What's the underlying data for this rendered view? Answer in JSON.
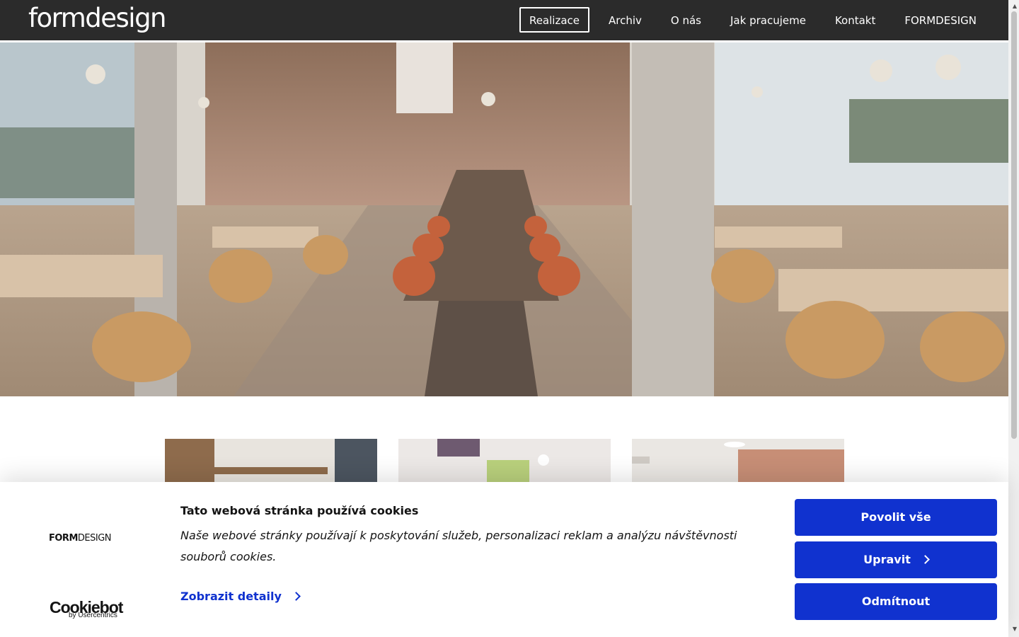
{
  "header": {
    "logo": "formdesign",
    "nav": [
      {
        "label": "Realizace",
        "active": true
      },
      {
        "label": "Archiv"
      },
      {
        "label": "O nás"
      },
      {
        "label": "Jak pracujeme"
      },
      {
        "label": "Kontakt"
      },
      {
        "label": "FORMDESIGN"
      }
    ],
    "background": "#2b2b2b"
  },
  "hero": {
    "subject": "restaurant interior with long table and orange chairs"
  },
  "cookie_banner": {
    "brand_prefix": "FORM",
    "brand_suffix": "DESIGN",
    "title": "Tato webová stránka používá cookies",
    "text": " Naše webové stránky používají k poskytování služeb, personalizaci reklam a analýzu návštěvnosti souborů cookies.",
    "details_link": "Zobrazit detaily",
    "buttons": {
      "allow_all": "Povolit vše",
      "customize": "Upravit",
      "deny": "Odmítnout"
    },
    "provider_logo": "Cookiebot",
    "provider_sub": "by Usercentrics",
    "accent_color": "#1032cf"
  }
}
